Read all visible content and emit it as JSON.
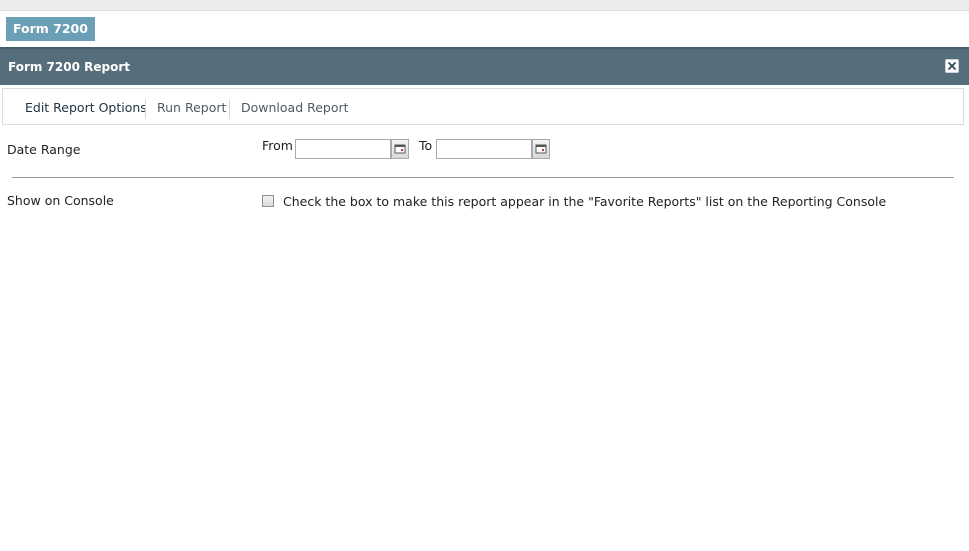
{
  "tab": {
    "label": "Form 7200"
  },
  "dialog": {
    "title": "Form 7200 Report",
    "close_icon": "close-icon"
  },
  "options_bar": {
    "items": [
      {
        "label": "Edit Report Options",
        "active": true
      },
      {
        "label": "Run Report",
        "active": false
      },
      {
        "label": "Download Report",
        "active": false
      }
    ]
  },
  "date_range": {
    "label": "Date Range",
    "from_label": "From",
    "from_value": "",
    "to_label": "To",
    "to_value": "",
    "calendar_icon": "calendar-icon"
  },
  "show_on_console": {
    "label": "Show on Console",
    "checked": false,
    "description": "Check the box to make this report appear in the \"Favorite Reports\" list on the Reporting Console"
  },
  "colors": {
    "tab_bg": "#6a9fb5",
    "title_bar_bg": "#566e7c"
  }
}
